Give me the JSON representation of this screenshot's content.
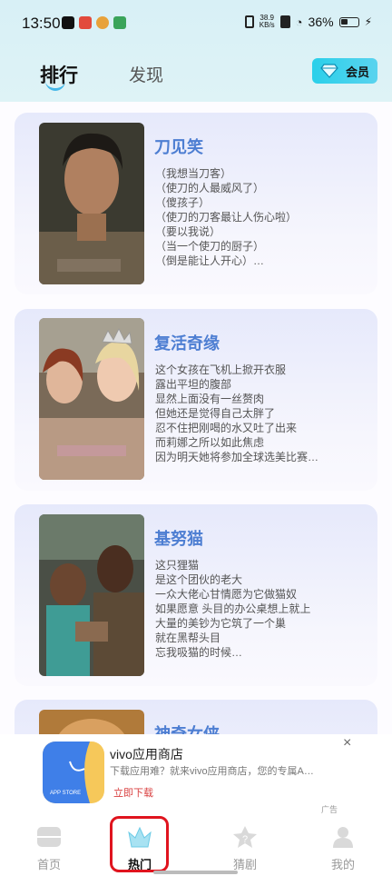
{
  "status_bar": {
    "time": "13:50",
    "net_speed_value": "38.9",
    "net_speed_unit": "KB/s",
    "battery": "36%"
  },
  "header": {
    "tab_rank": "排行",
    "tab_discover": "发现",
    "vip_label": "会员",
    "colors": {
      "accent": "#45b7e8",
      "vip_bg": "#2ad0ea"
    }
  },
  "cards": [
    {
      "title": "刀见笑",
      "lines": [
        "（我想当刀客）",
        "（使刀的人最威风了）",
        "（傻孩子）",
        "（使刀的刀客最让人伤心啦）",
        "（要以我说）",
        "（当一个使刀的厨子）",
        "（倒是能让人开心）…"
      ]
    },
    {
      "title": "复活奇缘",
      "lines": [
        "这个女孩在飞机上掀开衣服",
        "露出平坦的腹部",
        "显然上面没有一丝赘肉",
        "但她还是觉得自己太胖了",
        "忍不住把刚喝的水又吐了出来",
        "而莉娜之所以如此焦虑",
        "因为明天她将参加全球选美比赛…"
      ]
    },
    {
      "title": "基努猫",
      "lines": [
        "这只狸猫",
        "是这个团伙的老大",
        "一众大佬心甘情愿为它做猫奴",
        "如果愿意 头目的办公桌想上就上",
        "大量的美钞为它筑了一个巢",
        "就在黑帮头目",
        "忘我吸猫的时候…"
      ]
    },
    {
      "title": "神奇女侠",
      "lines": []
    }
  ],
  "ad": {
    "app_name": "vivo应用商店",
    "text": "下载应用难？就来vivo应用商店，您的专属A…",
    "cta": "立即下载",
    "close": "×",
    "tag": "广告",
    "icon_caption": "APP STORE"
  },
  "bottom_nav": {
    "items": [
      {
        "label": "首页",
        "icon": "home-icon"
      },
      {
        "label": "热门",
        "icon": "crown-icon"
      },
      {
        "label": "猜剧",
        "icon": "star-question-icon"
      },
      {
        "label": "我的",
        "icon": "user-icon"
      }
    ],
    "active_index": 1
  }
}
